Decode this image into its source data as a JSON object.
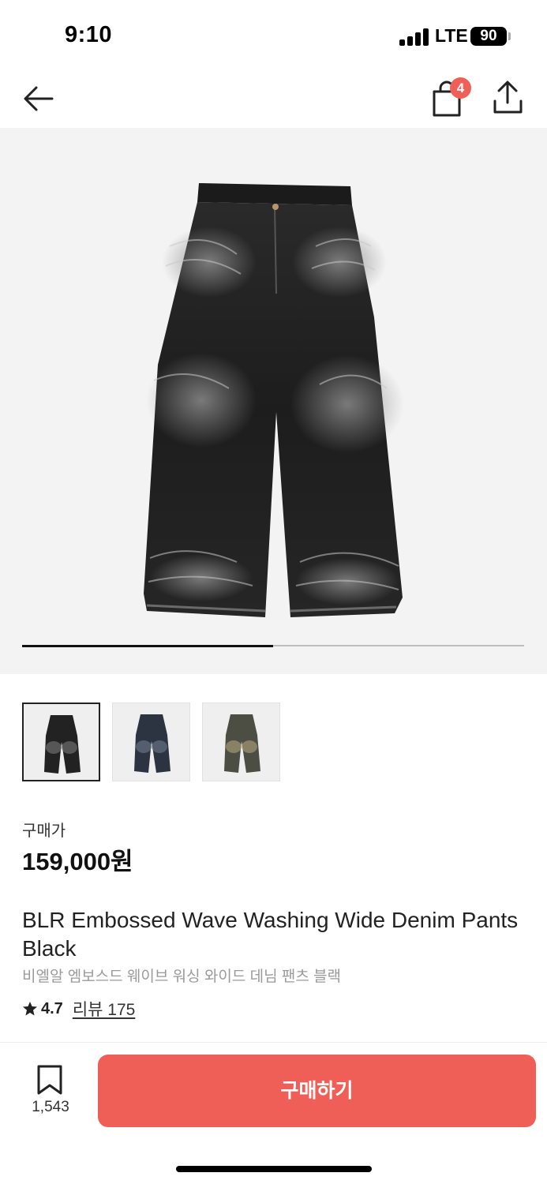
{
  "status_bar": {
    "time": "9:10",
    "network": "LTE",
    "battery": "90"
  },
  "nav": {
    "back_icon": "arrow-left-icon",
    "cart_icon": "shopping-bag-icon",
    "cart_badge": "4",
    "share_icon": "share-icon"
  },
  "gallery": {
    "image": "black washed wide denim pants photo",
    "progress": 0.5,
    "thumbnails": [
      {
        "icon": "jeans-black-thumbnail",
        "selected": true
      },
      {
        "icon": "jeans-dark-blue-thumbnail",
        "selected": false
      },
      {
        "icon": "jeans-khaki-thumbnail",
        "selected": false
      }
    ]
  },
  "product": {
    "price_label": "구매가",
    "price": "159,000원",
    "title_en": "BLR Embossed Wave Washing Wide Denim Pants Black",
    "title_ko": "비엘알 엠보스드 웨이브 워싱 와이드 데님 팬츠 블랙",
    "rating": "4.7",
    "review_link": "리뷰 175"
  },
  "bottom_bar": {
    "bookmark_count": "1,543",
    "buy_label": "구매하기"
  },
  "colors": {
    "accent": "#ef5f57",
    "hero_bg": "#f3f3f3",
    "text": "#222222",
    "muted": "#9a9a9a"
  }
}
